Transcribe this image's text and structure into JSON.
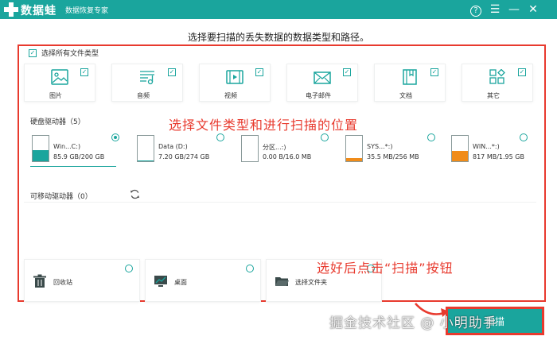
{
  "app": {
    "name": "数据蛙",
    "subtitle": "数据恢复专家",
    "help_glyph": "?",
    "menu_glyph": "☰",
    "minimize_glyph": "—",
    "close_glyph": "✕"
  },
  "heading": "选择要扫描的丢失数据的数据类型和路径。",
  "select_all": {
    "label": "选择所有文件类型",
    "checked": true
  },
  "file_types": [
    {
      "label": "图片",
      "icon": "image-icon",
      "checked": true
    },
    {
      "label": "音频",
      "icon": "audio-icon",
      "checked": true
    },
    {
      "label": "视频",
      "icon": "video-icon",
      "checked": true
    },
    {
      "label": "电子邮件",
      "icon": "email-icon",
      "checked": true
    },
    {
      "label": "文档",
      "icon": "document-icon",
      "checked": true
    },
    {
      "label": "其它",
      "icon": "other-icon",
      "checked": true
    }
  ],
  "hard_drives": {
    "title": "硬盘驱动器（5）",
    "items": [
      {
        "name": "Win...C:)",
        "size": "85.9 GB/200 GB",
        "used": 0.43,
        "selected": true
      },
      {
        "name": "Data (D:)",
        "size": "7.20 GB/274 GB",
        "used": 0.03,
        "selected": false
      },
      {
        "name": "分区...:)",
        "size": "0.00  B/16.0 MB",
        "used": 0.0,
        "selected": false
      },
      {
        "name": "SYS...*:)",
        "size": "35.5 MB/256 MB",
        "used": 0.14,
        "selected": false
      },
      {
        "name": "WIN...*:)",
        "size": "817 MB/1.95 GB",
        "used": 0.42,
        "selected": false
      }
    ]
  },
  "removable": {
    "title": "可移动驱动器（0）",
    "refresh_icon": "refresh-icon"
  },
  "locations": [
    {
      "label": "回收站",
      "icon": "recycle-bin-icon"
    },
    {
      "label": "桌面",
      "icon": "desktop-icon"
    },
    {
      "label": "选择文件夹",
      "icon": "folder-icon"
    }
  ],
  "annotations": {
    "top": "选择文件类型和进行扫描的位置",
    "bottom": "选好后点击“扫描”按钮"
  },
  "scan_button": {
    "label": "扫描"
  },
  "watermark": "掘金技术社区 @ 小明助手",
  "colors": {
    "accent": "#1aa59d",
    "annotation": "#e83a2e",
    "drive_fill_main": "#1aa59d",
    "drive_fill_other": "#f08c1a"
  }
}
